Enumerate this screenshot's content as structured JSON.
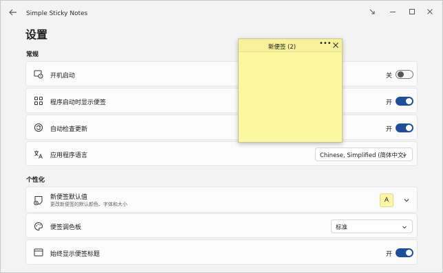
{
  "app": {
    "title": "Simple Sticky Notes"
  },
  "page": {
    "title": "设置"
  },
  "sections": {
    "general": "常规",
    "personalization": "个性化"
  },
  "settings": {
    "startup": {
      "label": "开机启动",
      "state": "关",
      "on": false
    },
    "show_notes": {
      "label": "程序启动时显示便签",
      "state": "开",
      "on": true
    },
    "auto_update": {
      "label": "自动检查更新",
      "state": "开",
      "on": true
    },
    "language": {
      "label": "应用程序语言",
      "value": "Chinese, Simplified (简体中文)"
    },
    "default_note": {
      "label": "新便签默认值",
      "sublabel": "更改新便签的默认颜色、字体和大小",
      "color_button": "A"
    },
    "palette": {
      "label": "便签调色板",
      "value": "标准"
    },
    "always_title": {
      "label": "始终显示便签标题",
      "state": "开",
      "on": true
    }
  },
  "sticky_note": {
    "title": "新便签 (2)",
    "more": "•••",
    "color": "#fbf8a0"
  },
  "colors": {
    "accent": "#1f4e9c",
    "note_yellow": "#fbf8a0"
  }
}
